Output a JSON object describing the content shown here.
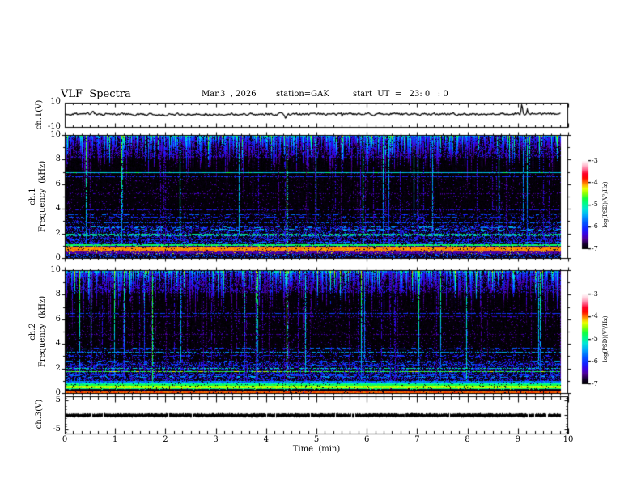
{
  "title": {
    "main": "VLF  Spectra",
    "date": "Mar.3  , 2026",
    "station": "station=GAK",
    "start": "start  UT  =   23: 0   : 0"
  },
  "x_axis": {
    "label": "Time  (min)",
    "ticks": [
      "0",
      "1",
      "2",
      "3",
      "4",
      "5",
      "6",
      "7",
      "8",
      "9",
      "10"
    ],
    "minor_per_major": 6,
    "data_end_min": 9.85
  },
  "colorbar": {
    "label": "log(PSD)(V²/Hz)",
    "ticks": [
      "-3",
      "-4",
      "-5",
      "-6",
      "-7"
    ],
    "colormap_stops": [
      {
        "t": 0.0,
        "rgb": [
          0,
          0,
          0
        ]
      },
      {
        "t": 0.05,
        "rgb": [
          20,
          0,
          45
        ]
      },
      {
        "t": 0.11,
        "rgb": [
          80,
          0,
          150
        ]
      },
      {
        "t": 0.16,
        "rgb": [
          60,
          0,
          220
        ]
      },
      {
        "t": 0.22,
        "rgb": [
          20,
          30,
          255
        ]
      },
      {
        "t": 0.3,
        "rgb": [
          0,
          90,
          255
        ]
      },
      {
        "t": 0.38,
        "rgb": [
          0,
          170,
          250
        ]
      },
      {
        "t": 0.45,
        "rgb": [
          0,
          230,
          215
        ]
      },
      {
        "t": 0.51,
        "rgb": [
          0,
          250,
          140
        ]
      },
      {
        "t": 0.57,
        "rgb": [
          20,
          255,
          60
        ]
      },
      {
        "t": 0.63,
        "rgb": [
          150,
          255,
          0
        ]
      },
      {
        "t": 0.68,
        "rgb": [
          235,
          255,
          0
        ]
      },
      {
        "t": 0.72,
        "rgb": [
          255,
          180,
          0
        ]
      },
      {
        "t": 0.76,
        "rgb": [
          255,
          90,
          0
        ]
      },
      {
        "t": 0.8,
        "rgb": [
          255,
          10,
          0
        ]
      },
      {
        "t": 0.85,
        "rgb": [
          255,
          0,
          40
        ]
      },
      {
        "t": 0.9,
        "rgb": [
          255,
          110,
          150
        ]
      },
      {
        "t": 0.95,
        "rgb": [
          255,
          200,
          215
        ]
      },
      {
        "t": 1.0,
        "rgb": [
          255,
          255,
          255
        ]
      }
    ]
  },
  "panels": {
    "ch1_wave": {
      "label": "ch.1(V)",
      "ytick_top": "10",
      "ytick_bottom": "-10"
    },
    "ch1_spec": {
      "label_channel": "ch.1",
      "label_axis": "Frequency  (kHz)",
      "yticks": [
        "10",
        "8",
        "6",
        "4",
        "2",
        "0"
      ]
    },
    "ch2_spec": {
      "label_channel": "ch.2",
      "label_axis": "Frequency  (kHz)",
      "yticks": [
        "10",
        "8",
        "6",
        "4",
        "2",
        "0"
      ]
    },
    "ch3_wave": {
      "label": "ch.3(V)",
      "ytick_top": "5",
      "ytick_bottom": "-5"
    }
  },
  "chart_data": [
    {
      "type": "line",
      "name": "ch.1(V) waveform",
      "xlabel": "Time (min)",
      "x_range": [
        0,
        10
      ],
      "x_data_end": 9.85,
      "ylabel": "ch.1(V)",
      "y_range": [
        -10,
        10
      ],
      "yticks": [
        10,
        -10
      ],
      "baseline_v": 0.9,
      "noise_amp_v": 1.5,
      "spikes": [
        {
          "t_min": 0.55,
          "amp_v": 2.2,
          "w_min": 0.02
        },
        {
          "t_min": 4.38,
          "amp_v": -3.4,
          "w_min": 0.012
        },
        {
          "t_min": 9.07,
          "amp_v": 8.2,
          "w_min": 0.014
        },
        {
          "t_min": 9.18,
          "amp_v": 4.2,
          "w_min": 0.011
        }
      ],
      "seed": 11
    },
    {
      "type": "heatmap",
      "name": "ch.1 spectrogram",
      "xlabel": "Time (min)",
      "x_range": [
        0,
        10
      ],
      "x_data_end": 9.85,
      "ylabel": "ch.1 Frequency (kHz)",
      "y_range": [
        0,
        10
      ],
      "yticks": [
        0,
        2,
        4,
        6,
        8,
        10
      ],
      "z_label": "log(PSD)(V²/Hz)",
      "z_range": [
        -7,
        -3
      ],
      "background_v": -7,
      "sferic_band": {
        "f_top": 10,
        "f_typical_bottom": 8,
        "column_probability": 0.9
      },
      "diffuse_band": {
        "f_lo": 1.0,
        "f_hi": 2.6,
        "v": -6.3
      },
      "thin_column_p": 0.045,
      "h_lines": [
        {
          "f": 6.93,
          "v": -5.35,
          "th": 1,
          "p": 1.0
        },
        {
          "f": 6.93,
          "v": -4.95,
          "th": 1,
          "p": 0.18,
          "speckle": true
        },
        {
          "f": 6.6,
          "v": -6.0,
          "th": 1,
          "p": 0.7
        },
        {
          "f": 5.2,
          "v": -6.5,
          "th": 1,
          "p": 0.3
        },
        {
          "f": 3.93,
          "v": -6.2,
          "th": 1,
          "p": 0.5
        },
        {
          "f": 3.55,
          "v": -5.9,
          "th": 2,
          "p": 0.5,
          "speckle": true
        },
        {
          "f": 3.3,
          "v": -6.0,
          "th": 2,
          "p": 0.45,
          "speckle": true
        },
        {
          "f": 2.83,
          "v": -5.8,
          "th": 1,
          "p": 0.55
        },
        {
          "f": 2.5,
          "v": -5.6,
          "th": 2,
          "p": 0.35,
          "speckle": true
        },
        {
          "f": 2.27,
          "v": -5.5,
          "th": 2,
          "p": 0.32,
          "speckle": true
        },
        {
          "f": 1.97,
          "v": -4.95,
          "th": 1,
          "p": 0.65
        },
        {
          "f": 1.83,
          "v": -5.2,
          "th": 1,
          "p": 0.55
        },
        {
          "f": 1.52,
          "v": -5.95,
          "th": 2,
          "p": 0.42,
          "speckle": true
        },
        {
          "f": 1.28,
          "v": -5.7,
          "th": 2,
          "p": 0.45,
          "speckle": true
        }
      ],
      "bottom_bands": [
        {
          "f_lo": 1.03,
          "f_hi": 1.13,
          "v": -4.85,
          "jit": 0.15
        },
        {
          "f_lo": 0.93,
          "f_hi": 1.01,
          "v": -6.6,
          "jit": 0.2,
          "speckle_p": 0.18,
          "speckle_v": -4.5
        },
        {
          "f_lo": 0.62,
          "f_hi": 0.88,
          "v": -4.05,
          "jit": 0.07
        },
        {
          "f_lo": 0.35,
          "f_hi": 0.6,
          "v": -6.5,
          "jit": 0.1,
          "speckle_p": 0.06,
          "speckle_v": -4.3
        },
        {
          "f_lo": 0.08,
          "f_hi": 0.33,
          "v": -6.85,
          "jit": 0.1,
          "speckle_p": 0.3,
          "speckle_v": -5.85
        }
      ],
      "bright_streaks": [
        {
          "t_min": 2.28,
          "f_lo": 1.1,
          "v": -5.0
        },
        {
          "t_min": 3.46,
          "f_lo": 2.0,
          "v": -5.4
        },
        {
          "t_min": 4.4,
          "f_lo": 0.3,
          "v": -4.6
        },
        {
          "t_min": 5.92,
          "f_lo": 1.2,
          "v": -5.0
        },
        {
          "t_min": 7.3,
          "f_lo": 2.2,
          "v": -5.5
        },
        {
          "t_min": 8.62,
          "f_lo": 1.5,
          "v": -5.3
        },
        {
          "t_min": 9.1,
          "f_lo": 3.0,
          "v": -5.6
        }
      ],
      "seed": 23
    },
    {
      "type": "heatmap",
      "name": "ch.2 spectrogram",
      "xlabel": "Time (min)",
      "x_range": [
        0,
        10
      ],
      "x_data_end": 9.85,
      "ylabel": "ch.2 Frequency (kHz)",
      "y_range": [
        0,
        10
      ],
      "yticks": [
        0,
        2,
        4,
        6,
        8,
        10
      ],
      "z_label": "log(PSD)(V²/Hz)",
      "z_range": [
        -7,
        -3
      ],
      "background_v": -7,
      "sferic_band": {
        "f_top": 10,
        "f_typical_bottom": 8,
        "column_probability": 0.84
      },
      "diffuse_band": {
        "f_lo": 1.0,
        "f_hi": 2.6,
        "v": -6.3
      },
      "thin_column_p": 0.07,
      "h_lines": [
        {
          "f": 6.5,
          "v": -6.0,
          "th": 1,
          "p": 0.65
        },
        {
          "f": 6.22,
          "v": -6.3,
          "th": 1,
          "p": 0.4
        },
        {
          "f": 4.75,
          "v": -6.5,
          "th": 1,
          "p": 0.3
        },
        {
          "f": 3.6,
          "v": -5.8,
          "th": 2,
          "p": 0.5,
          "speckle": true
        },
        {
          "f": 3.35,
          "v": -5.5,
          "th": 1,
          "p": 0.65
        },
        {
          "f": 3.05,
          "v": -6.05,
          "th": 2,
          "p": 0.45,
          "speckle": true
        },
        {
          "f": 2.55,
          "v": -5.7,
          "th": 2,
          "p": 0.35,
          "speckle": true
        },
        {
          "f": 2.3,
          "v": -5.85,
          "th": 2,
          "p": 0.35,
          "speckle": true
        },
        {
          "f": 2.0,
          "v": -5.1,
          "th": 1,
          "p": 0.6
        },
        {
          "f": 1.72,
          "v": -4.75,
          "th": 1,
          "p": 0.85
        },
        {
          "f": 1.72,
          "v": -4.3,
          "th": 1,
          "p": 0.12,
          "speckle": true
        },
        {
          "f": 1.45,
          "v": -5.9,
          "th": 2,
          "p": 0.4,
          "speckle": true
        },
        {
          "f": 1.3,
          "v": -5.6,
          "th": 2,
          "p": 0.35,
          "speckle": true
        }
      ],
      "bottom_bands": [
        {
          "f_lo": 0.95,
          "f_hi": 1.0,
          "v": -5.7,
          "jit": 0.25
        },
        {
          "f_lo": 0.81,
          "f_hi": 0.86,
          "v": -5.1,
          "jit": 0.2
        },
        {
          "f_lo": 0.67,
          "f_hi": 0.72,
          "v": -4.8,
          "jit": 0.15
        },
        {
          "f_lo": 0.48,
          "f_hi": 0.57,
          "v": -4.4,
          "jit": 0.1
        },
        {
          "f_lo": 0.36,
          "f_hi": 0.41,
          "v": -4.9,
          "jit": 0.15,
          "speckle_p": 0.1,
          "speckle_v": -4.4
        },
        {
          "f_lo": 0.13,
          "f_hi": 0.33,
          "v": -6.9,
          "jit": 0.08
        },
        {
          "f_lo": 0.04,
          "f_hi": 0.11,
          "v": -3.95,
          "jit": 0.1
        }
      ],
      "bright_streaks": [
        {
          "t_min": 1.73,
          "f_lo": 0.4,
          "v": -4.8
        },
        {
          "t_min": 2.3,
          "f_lo": 2.5,
          "v": -5.5
        },
        {
          "t_min": 4.4,
          "f_lo": 0.2,
          "v": -4.5
        },
        {
          "t_min": 4.78,
          "f_lo": 1.5,
          "v": -5.3
        },
        {
          "t_min": 5.95,
          "f_lo": 2.8,
          "v": -5.6
        },
        {
          "t_min": 7.97,
          "f_lo": 1.0,
          "v": -5.2
        },
        {
          "t_min": 9.4,
          "f_lo": 2.0,
          "v": -5.4
        }
      ],
      "seed": 37
    },
    {
      "type": "line",
      "name": "ch.3(V) waveform",
      "xlabel": "Time (min)",
      "x_range": [
        0,
        10
      ],
      "x_data_end": 9.85,
      "ylabel": "ch.3(V)",
      "y_range": [
        -6.5,
        6.5
      ],
      "yticks": [
        5,
        -5
      ],
      "constant_v": 0,
      "line_thickness_v": 0.9,
      "seed": 7
    }
  ]
}
